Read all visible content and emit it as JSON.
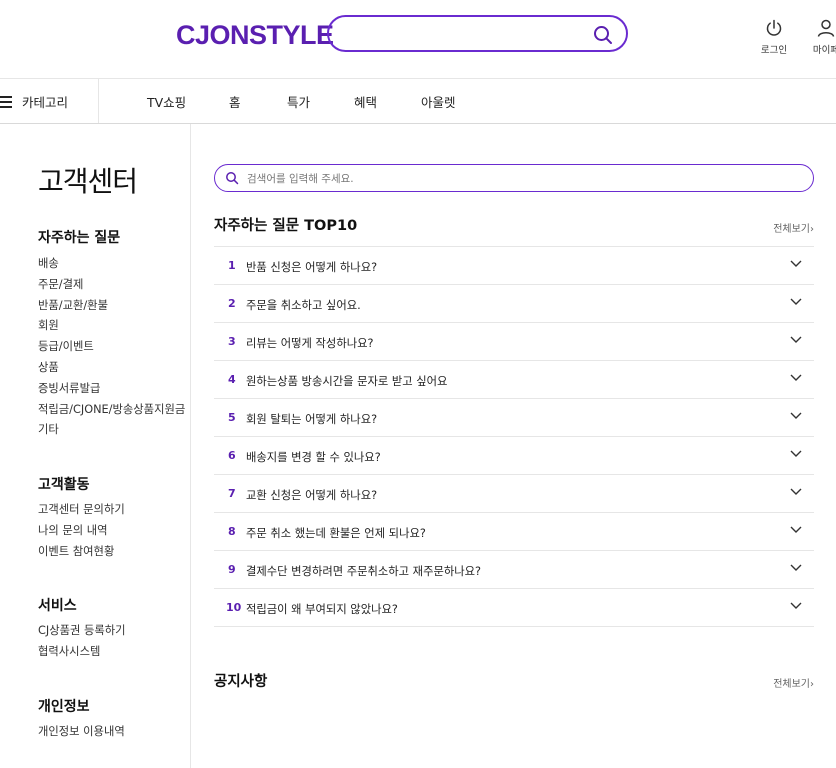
{
  "header": {
    "logo": "CJONSTYLE",
    "login_label": "로그인",
    "mypage_label": "마이페"
  },
  "nav": {
    "category_label": "카테고리",
    "items": [
      "TV쇼핑",
      "홈",
      "특가",
      "혜택",
      "아울렛"
    ]
  },
  "sidebar": {
    "page_title": "고객센터",
    "sections": [
      {
        "title": "자주하는 질문",
        "items": [
          "배송",
          "주문/결제",
          "반품/교환/환불",
          "회원",
          "등급/이벤트",
          "상품",
          "증빙서류발급",
          "적립금/CJONE/방송상품지원금",
          "기타"
        ]
      },
      {
        "title": "고객활동",
        "items": [
          "고객센터 문의하기",
          "나의 문의 내역",
          "이벤트 참여현황"
        ]
      },
      {
        "title": "서비스",
        "items": [
          "CJ상품권 등록하기",
          "협력사시스템"
        ]
      },
      {
        "title": "개인정보",
        "items": [
          "개인정보 이용내역"
        ]
      }
    ]
  },
  "main": {
    "search_placeholder": "검색어를 입력해 주세요.",
    "faq_title": "자주하는 질문 TOP10",
    "view_all": "전체보기",
    "faq": [
      {
        "num": "1",
        "q": "반품 신청은 어떻게 하나요?"
      },
      {
        "num": "2",
        "q": "주문을 취소하고 싶어요."
      },
      {
        "num": "3",
        "q": "리뷰는 어떻게 작성하나요?"
      },
      {
        "num": "4",
        "q": "원하는상품 방송시간을 문자로 받고 싶어요"
      },
      {
        "num": "5",
        "q": "회원 탈퇴는 어떻게 하나요?"
      },
      {
        "num": "6",
        "q": "배송지를 변경 할 수 있나요?"
      },
      {
        "num": "7",
        "q": "교환 신청은 어떻게 하나요?"
      },
      {
        "num": "8",
        "q": "주문 취소 했는데 환불은 언제 되나요?"
      },
      {
        "num": "9",
        "q": "결제수단 변경하려면 주문취소하고 재주문하나요?"
      },
      {
        "num": "10",
        "q": "적립금이 왜 부여되지 않았나요?"
      }
    ],
    "notice_title": "공지사항",
    "notice_view_all": "전체보기"
  }
}
